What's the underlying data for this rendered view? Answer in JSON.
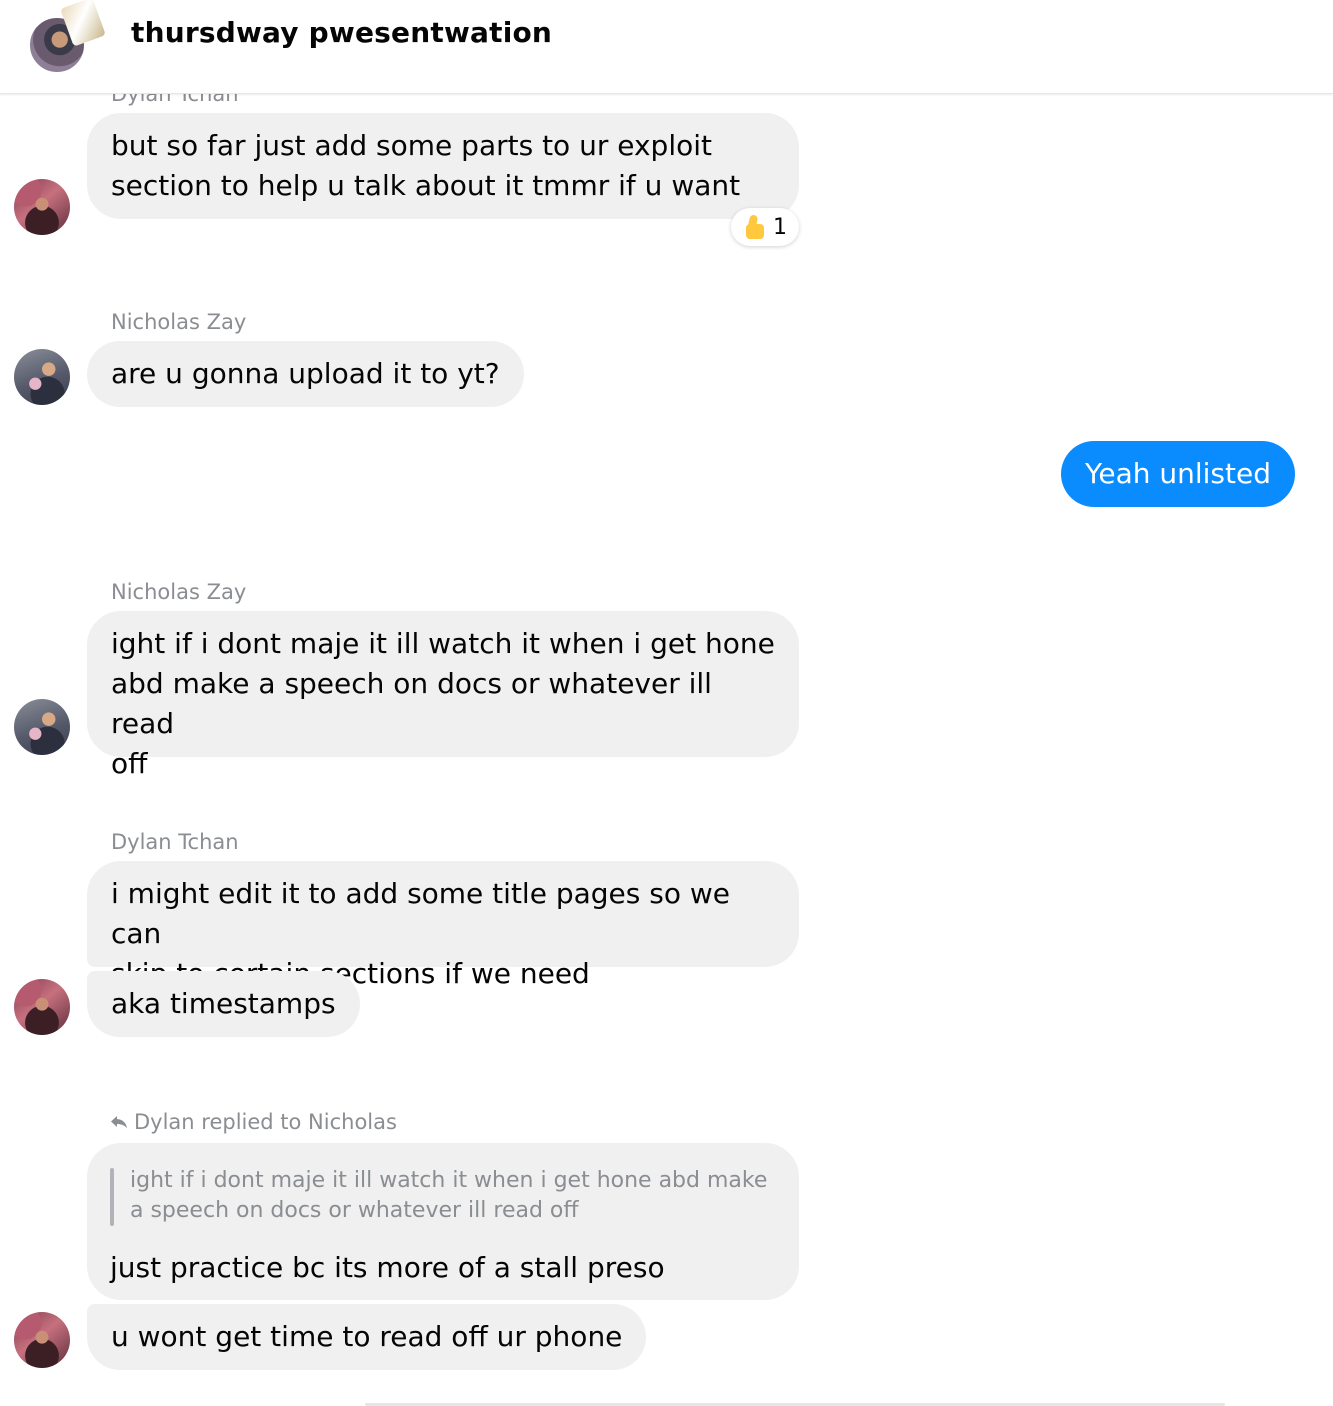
{
  "header": {
    "title": "thursdway pwesentwation"
  },
  "messages": {
    "m1": {
      "sender": "Dylan Tchan",
      "text": "but so far just add some parts to ur exploit\nsection to help u talk about it tmmr if u want",
      "reaction": {
        "icon": "thumbs-up-icon",
        "count": "1"
      }
    },
    "m2": {
      "sender": "Nicholas Zay",
      "text": "are u gonna upload it to yt?"
    },
    "m3": {
      "text": "Yeah unlisted",
      "color": "#0a8cff"
    },
    "m4": {
      "sender": "Nicholas Zay",
      "text": "ight if i dont maje it ill watch it when i get hone\nabd make a speech on docs or whatever ill read\noff"
    },
    "m5": {
      "sender": "Dylan Tchan",
      "text1": "i might edit it to add some title pages so we can\nskip to certain sections if we need",
      "text2": "aka timestamps"
    },
    "m6": {
      "reply_label": "Dylan replied to Nicholas",
      "quoted": "ight if i dont maje it ill watch it when i get hone abd make a speech on docs or whatever ill read off",
      "text1": "just practice bc its more of a stall preso",
      "text2": "u wont get time to read off ur phone"
    }
  }
}
